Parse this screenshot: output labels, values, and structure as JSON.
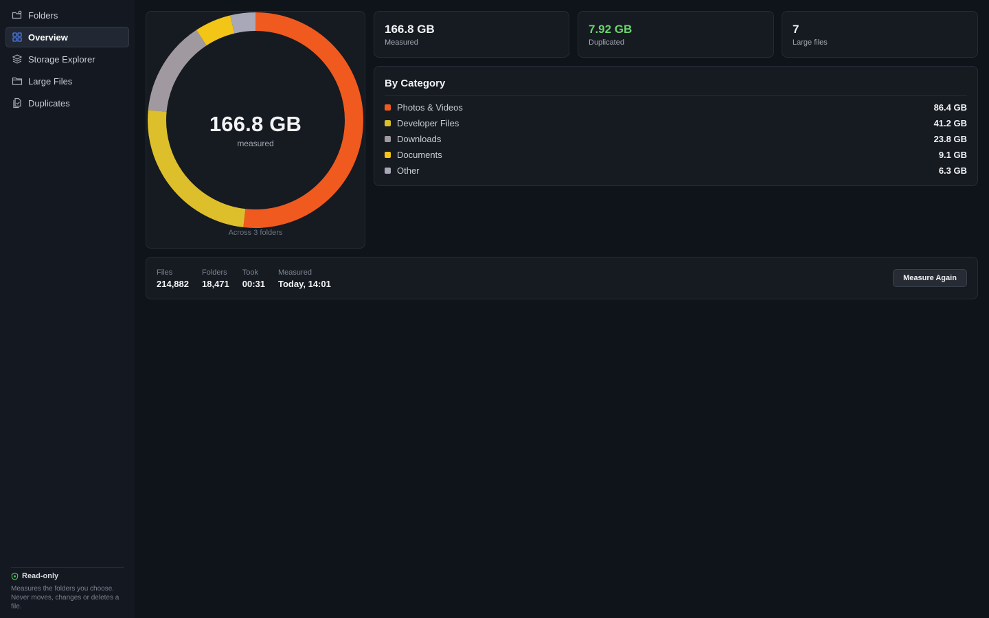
{
  "sidebar": {
    "items": [
      {
        "label": "Folders",
        "icon": "folder-settings-icon"
      },
      {
        "label": "Overview",
        "icon": "grid-icon",
        "active": true
      },
      {
        "label": "Storage Explorer",
        "icon": "layers-icon"
      },
      {
        "label": "Large Files",
        "icon": "folder-icon"
      },
      {
        "label": "Duplicates",
        "icon": "duplicate-files-icon"
      }
    ],
    "footer": {
      "title": "Read-only",
      "description": "Measures the folders you choose. Never moves, changes or deletes a file."
    }
  },
  "donut": {
    "value": "166.8 GB",
    "label": "measured",
    "footnote": "Across 3 folders"
  },
  "stats": [
    {
      "value": "166.8 GB",
      "label": "Measured",
      "highlight": false
    },
    {
      "value": "7.92 GB",
      "label": "Duplicated",
      "highlight": true
    },
    {
      "value": "7",
      "label": "Large files",
      "highlight": false
    }
  ],
  "categories": {
    "title": "By Category",
    "items": [
      {
        "name": "Photos & Videos",
        "size": "86.4 GB",
        "gb": 86.4,
        "color": "#f05a1e"
      },
      {
        "name": "Developer Files",
        "size": "41.2 GB",
        "gb": 41.2,
        "color": "#dcbf2a"
      },
      {
        "name": "Downloads",
        "size": "23.8 GB",
        "gb": 23.8,
        "color": "#a09aa0"
      },
      {
        "name": "Documents",
        "size": "9.1 GB",
        "gb": 9.1,
        "color": "#f3c517"
      },
      {
        "name": "Other",
        "size": "6.3 GB",
        "gb": 6.3,
        "color": "#a8a8b8"
      }
    ]
  },
  "summary": {
    "files_label": "Files",
    "files_value": "214,882",
    "folders_label": "Folders",
    "folders_value": "18,471",
    "took_label": "Took",
    "took_value": "00:31",
    "measured_label": "Measured",
    "measured_value": "Today, 14:01",
    "button_label": "Measure Again"
  },
  "colors": {
    "accent_green": "#6bd56e",
    "active_icon": "#4a7cf0"
  }
}
